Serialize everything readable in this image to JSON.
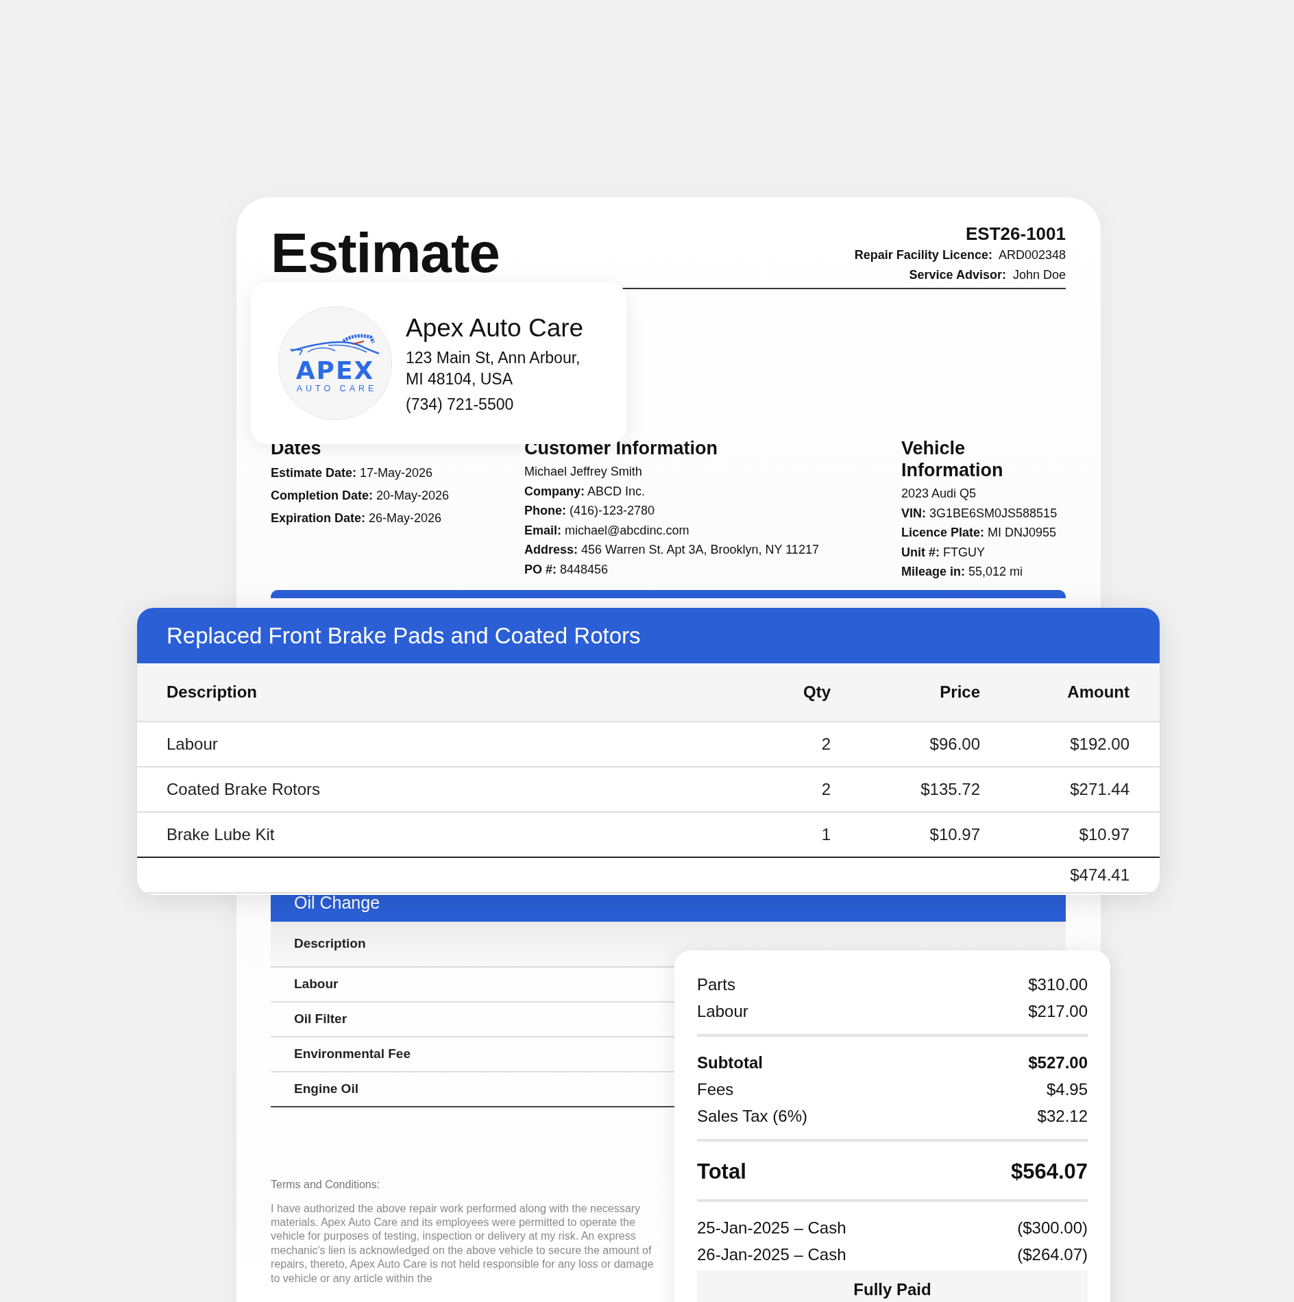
{
  "document": {
    "title": "Estimate",
    "number": "EST26-1001",
    "meta": [
      {
        "label": "Repair Facility Licence:",
        "value": "ARD002348"
      },
      {
        "label": "Service Advisor:",
        "value": "John Doe"
      }
    ]
  },
  "business": {
    "name": "Apex Auto Care",
    "address_lines": [
      "123 Main St, Ann Arbour,",
      "MI 48104, USA"
    ],
    "phone": "(734) 721-5500",
    "logo_text": "APEX",
    "logo_subtext": "AUTO CARE"
  },
  "info_columns": [
    {
      "heading": "Dates",
      "rows": [
        {
          "label": "Estimate Date:",
          "value": "17-May-2026"
        },
        {
          "label": "Completion Date:",
          "value": "20-May-2026"
        },
        {
          "label": "Expiration Date:",
          "value": "26-May-2026"
        }
      ]
    },
    {
      "heading": "Customer Information",
      "rows": [
        {
          "value": "Michael Jeffrey Smith"
        },
        {
          "label": "Company:",
          "value": "ABCD Inc."
        },
        {
          "label": "Phone:",
          "value": "(416)-123-2780"
        },
        {
          "label": "Email:",
          "value": "michael@abcdinc.com"
        },
        {
          "label": "Address:",
          "value": "456 Warren St. Apt 3A, Brooklyn, NY 11217"
        },
        {
          "label": "PO #:",
          "value": "8448456"
        }
      ]
    },
    {
      "heading": "Vehicle Information",
      "rows": [
        {
          "value": "2023 Audi Q5"
        },
        {
          "label": "VIN:",
          "value": "3G1BE6SM0JS588515"
        },
        {
          "label": "Licence Plate:",
          "value": "MI DNJ0955"
        },
        {
          "label": "Unit #:",
          "value": "FTGUY"
        },
        {
          "label": "Mileage in:",
          "value": "55,012 mi"
        }
      ]
    }
  ],
  "job_card": {
    "title": "Replaced Front Brake Pads and Coated Rotors",
    "columns": [
      "Description",
      "Qty",
      "Price",
      "Amount"
    ],
    "rows": [
      [
        "Labour",
        "2",
        "$96.00",
        "$192.00"
      ],
      [
        "Coated Brake Rotors",
        "2",
        "$135.72",
        "$271.44"
      ],
      [
        "Brake Lube Kit",
        "1",
        "$10.97",
        "$10.97"
      ]
    ],
    "total": "$474.41"
  },
  "oil_change": {
    "title": "Oil Change",
    "column": "Description",
    "rows": [
      "Labour",
      "Oil Filter",
      "Environmental Fee",
      "Engine Oil"
    ]
  },
  "terms": {
    "heading": "Terms and Conditions:",
    "text": "I have authorized the above repair work performed along with the necessary materials. Apex Auto Care and its employees were permitted to operate the vehicle for purposes of testing, inspection or delivery at my risk. An express mechanic's lien is acknowledged on the above vehicle to secure the amount of repairs,  thereto, Apex Auto Care is not held responsible for any loss or damage to vehicle or any article within the"
  },
  "summary": {
    "groups": [
      {
        "rows": [
          {
            "kind": "normal",
            "label": "Parts",
            "value": "$310.00"
          },
          {
            "kind": "normal",
            "label": "Labour",
            "value": "$217.00"
          }
        ]
      },
      {
        "rows": [
          {
            "kind": "bold",
            "label": "Subtotal",
            "value": "$527.00"
          },
          {
            "kind": "normal",
            "label": "Fees",
            "value": "$4.95"
          },
          {
            "kind": "normal",
            "label": "Sales Tax (6%)",
            "value": "$32.12"
          }
        ]
      },
      {
        "rows": [
          {
            "kind": "total",
            "label": "Total",
            "value": "$564.07"
          }
        ]
      },
      {
        "rows": [
          {
            "kind": "normal",
            "label": "25-Jan-2025 – Cash",
            "value": "($300.00)"
          },
          {
            "kind": "normal",
            "label": "26-Jan-2025 – Cash",
            "value": "($264.07)"
          }
        ]
      }
    ],
    "status": "Fully Paid"
  }
}
